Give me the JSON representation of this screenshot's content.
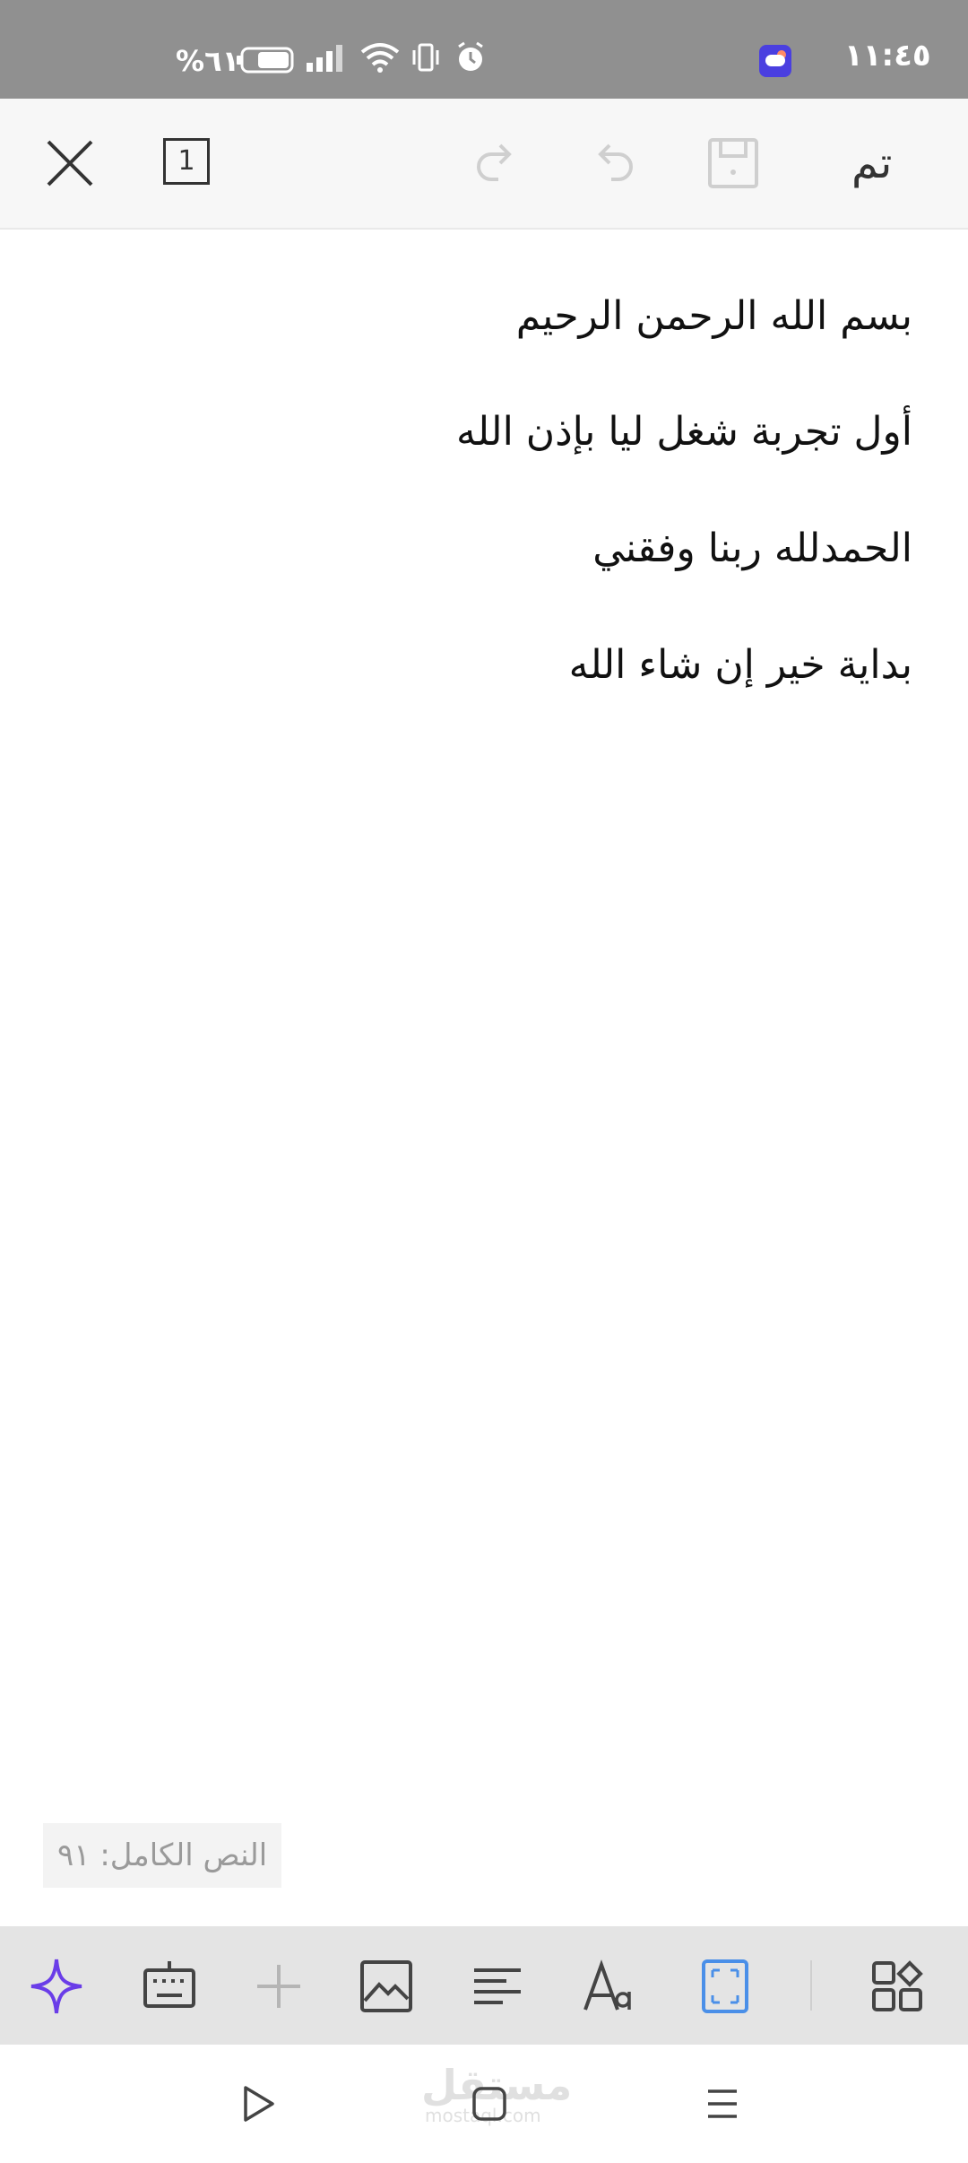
{
  "status_bar": {
    "time": "١١:٤٥",
    "battery": "%٦١",
    "icons": [
      "alarm-icon",
      "vibrate-icon",
      "wifi-icon",
      "signal-icon",
      "battery-icon",
      "weather-app-icon"
    ]
  },
  "toolbar": {
    "done_label": "تم",
    "page_count": "1",
    "icons": [
      "save-icon",
      "undo-icon",
      "redo-icon",
      "close-icon"
    ]
  },
  "document": {
    "lines": [
      "بسم الله الرحمن الرحيم",
      "أول تجربة شغل ليا بإذن الله",
      "الحمدلله ربنا وفقني",
      "بداية خير إن شاء الله"
    ],
    "word_count_label": "النص الكامل: ٩١"
  },
  "format_bar": {
    "icons": [
      "ai-sparkle-icon",
      "keyboard-icon",
      "insert-plus-icon",
      "image-icon",
      "align-icon",
      "font-icon",
      "fullscreen-icon",
      "layout-grid-icon"
    ],
    "ai_color": "#6a3de8",
    "active_color": "#4a8fe8"
  },
  "nav_bar": {
    "icons": [
      "back-icon",
      "home-icon",
      "recents-icon"
    ],
    "watermark": "مستقل",
    "watermark_sub": "mostaql.com"
  }
}
